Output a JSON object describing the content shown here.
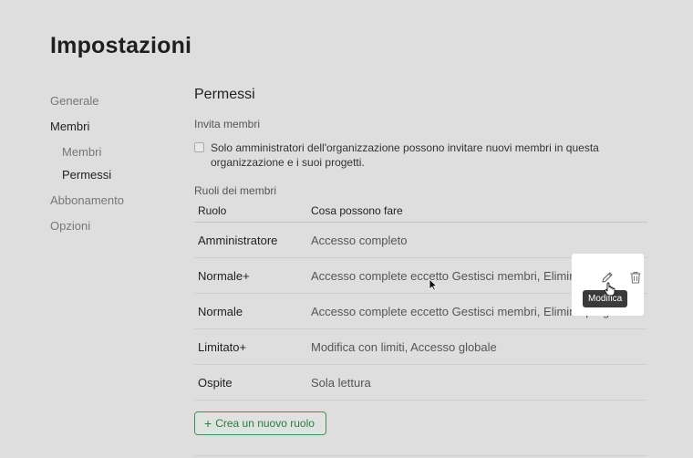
{
  "page": {
    "title": "Impostazioni"
  },
  "sidebar": {
    "items": [
      {
        "label": "Generale"
      },
      {
        "label": "Membri"
      },
      {
        "label": "Membri"
      },
      {
        "label": "Permessi"
      },
      {
        "label": "Abbonamento"
      },
      {
        "label": "Opzioni"
      }
    ]
  },
  "permissions": {
    "title": "Permessi",
    "invite_label": "Invita membri",
    "invite_checkbox_text": "Solo amministratori dell'organizzazione possono invitare nuovi membri in questa organizzazione e i suoi progetti.",
    "invite_checked": false,
    "roles_label": "Ruoli dei membri",
    "table": {
      "headers": {
        "role": "Ruolo",
        "desc": "Cosa possono fare"
      },
      "rows": [
        {
          "role": "Amministratore",
          "desc": "Accesso completo"
        },
        {
          "role": "Normale+",
          "desc": "Accesso complete eccetto Gestisci membri, Elimina progetti, Gestisci abbonamento"
        },
        {
          "role": "Normale",
          "desc": "Accesso complete eccetto Gestisci membri, Elimina progetti, Gestisci abbonamento"
        },
        {
          "role": "Limitato+",
          "desc": "Modifica con limiti, Accesso globale"
        },
        {
          "role": "Ospite",
          "desc": "Sola lettura"
        }
      ]
    },
    "create_button": "Crea un nuovo ruolo"
  },
  "row_actions": {
    "edit_icon": "pencil-icon",
    "delete_icon": "trash-icon",
    "tooltip": "Modifica"
  },
  "colors": {
    "accent": "#2d7a45",
    "background": "#dedede",
    "tooltip": "#3a3a3a"
  }
}
